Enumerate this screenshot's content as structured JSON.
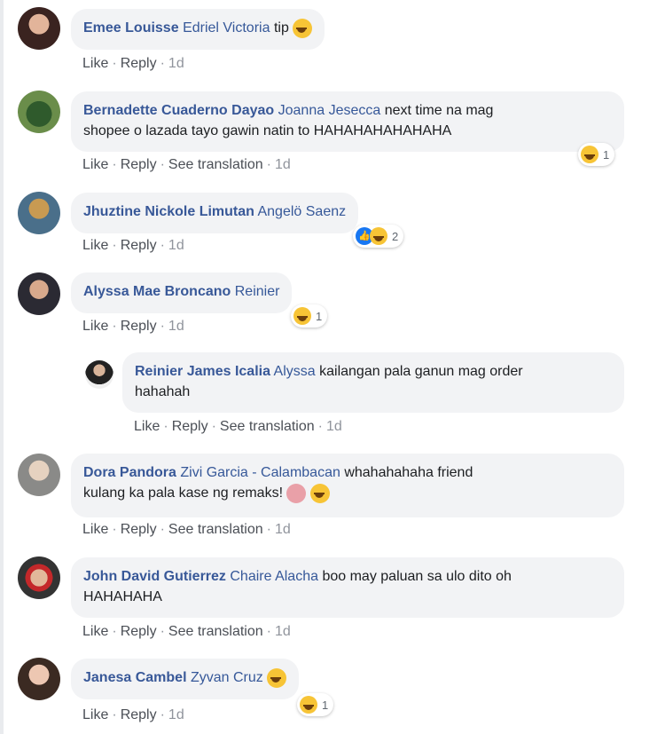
{
  "comments": [
    {
      "author": "Emee Louisse",
      "mention": "Edriel Victoria",
      "text": "tip",
      "like": "Like",
      "reply": "Reply",
      "time": "1d"
    },
    {
      "author": "Bernadette Cuaderno Dayao",
      "mention": "Joanna Jesecca",
      "text": "next time na mag",
      "text2": "shopee o lazada tayo gawin natin to HAHAHAHAHAHAHA",
      "like": "Like",
      "reply": "Reply",
      "translate": "See translation",
      "time": "1d",
      "react_count": "1"
    },
    {
      "author": "Jhuztine Nickole Limutan",
      "mention": "Angelö Saenz",
      "like": "Like",
      "reply": "Reply",
      "time": "1d",
      "react_count": "2"
    },
    {
      "author": "Alyssa Mae Broncano",
      "mention": "Reinier",
      "like": "Like",
      "reply": "Reply",
      "time": "1d",
      "react_count": "1"
    },
    {
      "author": "Reinier James Icalia",
      "mention": "Alyssa",
      "text": "kailangan pala ganun mag order",
      "text2": "hahahah",
      "like": "Like",
      "reply": "Reply",
      "translate": "See translation",
      "time": "1d"
    },
    {
      "author": "Dora Pandora",
      "mention": "Zivi Garcia - Calambacan",
      "text": "whahahahaha friend",
      "text2": "kulang ka pala kase ng remaks!",
      "like": "Like",
      "reply": "Reply",
      "translate": "See translation",
      "time": "1d"
    },
    {
      "author": "John David Gutierrez",
      "mention": "Chaire Alacha",
      "text": "boo may paluan sa ulo dito oh",
      "text2": "HAHAHAHA",
      "like": "Like",
      "reply": "Reply",
      "translate": "See translation",
      "time": "1d"
    },
    {
      "author": "Janesa Cambel",
      "mention": "Zyvan Cruz",
      "like": "Like",
      "reply": "Reply",
      "time": "1d",
      "react_count": "1"
    }
  ],
  "icons": {
    "like": "like-reaction-icon",
    "haha": "haha-reaction-icon",
    "woman": "woman-gesture-emoji"
  }
}
